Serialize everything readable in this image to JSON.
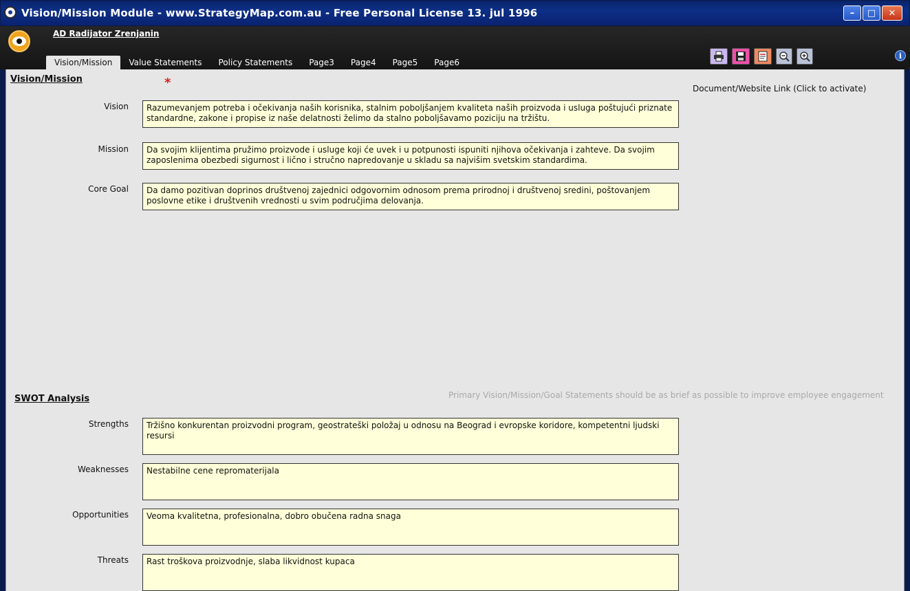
{
  "window": {
    "title": "Vision/Mission Module - www.StrategyMap.com.au - Free Personal License  13. jul 1996",
    "minimize_label": "–",
    "maximize_label": "□",
    "close_label": "✕"
  },
  "header": {
    "organization": "AD Radijator Zrenjanin",
    "tabs": [
      {
        "label": "Vision/Mission",
        "active": true
      },
      {
        "label": "Value Statements"
      },
      {
        "label": "Policy Statements"
      },
      {
        "label": "Page3"
      },
      {
        "label": "Page4"
      },
      {
        "label": "Page5"
      },
      {
        "label": "Page6"
      }
    ],
    "toolbar_icons": [
      "print-icon",
      "save-icon",
      "document-icon",
      "zoom-out-icon",
      "zoom-in-icon"
    ],
    "info_label": "i"
  },
  "vision_mission": {
    "title": "Vision/Mission",
    "required_marker": "*",
    "document_link_label": "Document/Website Link  (Click to activate)",
    "fields": [
      {
        "label": "Vision",
        "value": "Razumevanjem potreba i očekivanja naših korisnika, stalnim poboljšanjem kvaliteta naših proizvoda i usluga poštujući priznate standardne, zakone i propise iz naše delatnosti želimo da stalno poboljšavamo poziciju na tržištu."
      },
      {
        "label": "Mission",
        "value": "Da svojim klijentima pružimo proizvode i usluge koji će uvek i u potpunosti ispuniti njihova očekivanja i zahteve. Da svojim zaposlenima obezbedi sigurnost i lično i stručno napredovanje u skladu sa najvišim svetskim standardima."
      },
      {
        "label": "Core Goal",
        "value": "Da damo pozitivan doprinos društvenoj zajednici odgovornim odnosom prema prirodnoj i društvenoj sredini, poštovanjem poslovne etike i društvenih vrednosti u svim područjima delovanja."
      }
    ],
    "hint": "Primary Vision/Mission/Goal Statements should be as brief as possible to improve employee engagement"
  },
  "swot": {
    "title": "SWOT Analysis",
    "fields": [
      {
        "label": "Strengths",
        "value": "Tržišno konkurentan proizvodni program, geostrateški položaj u odnosu na Beograd i evropske koridore, kompetentni ljudski resursi"
      },
      {
        "label": "Weaknesses",
        "value": "Nestabilne cene repromaterijala"
      },
      {
        "label": "Opportunities",
        "value": "Veoma kvalitetna, profesionalna, dobro obučena radna snaga"
      },
      {
        "label": "Threats",
        "value": "Rast troškova proizvodnje, slaba likvidnost kupaca"
      }
    ]
  },
  "colors": {
    "titlebar": "#0a246a",
    "header": "#1c1c1c",
    "content_bg": "#e6e6e6",
    "field_bg": "#ffffd9",
    "required": "#e11c1c"
  }
}
